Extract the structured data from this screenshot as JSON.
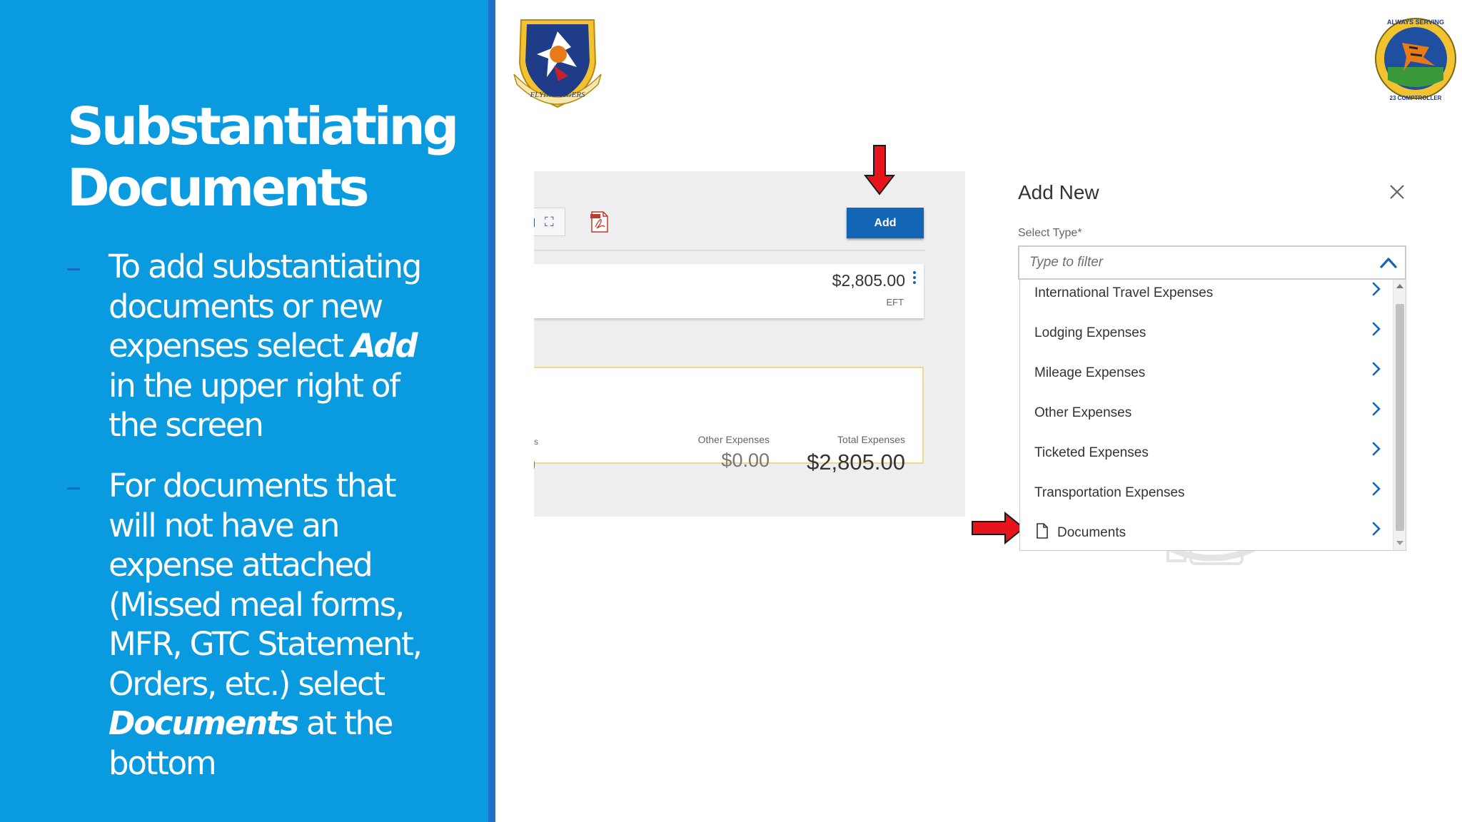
{
  "slide": {
    "title": "Substantiating Documents",
    "bullet1": {
      "pre": "To add substantiating documents or new expenses select ",
      "em": "Add",
      "post": " in the upper right of the screen"
    },
    "bullet2": {
      "pre": "For documents that will not have an expense attached (Missed meal forms, MFR, GTC Statement, Orders, etc.) select ",
      "em": "Documents",
      "post": " at the bottom"
    }
  },
  "emblems": {
    "left_text": "FLYING TIGERS",
    "right_top": "ALWAYS SERVING",
    "right_bottom": "23 COMPTROLLER"
  },
  "expense_view": {
    "add_label": "Add",
    "amount": "$2,805.00",
    "payment_method": "EFT",
    "prev_col_label": "s",
    "prev_col_value": ")",
    "other_label": "Other Expenses",
    "other_value": "$0.00",
    "total_label": "Total Expenses",
    "total_value": "$2,805.00"
  },
  "dialog": {
    "title": "Add New",
    "select_label": "Select Type*",
    "filter_placeholder": "Type to filter",
    "items": [
      {
        "label": "International Travel Expenses"
      },
      {
        "label": "Lodging Expenses"
      },
      {
        "label": "Mileage Expenses"
      },
      {
        "label": "Other Expenses"
      },
      {
        "label": "Ticketed Expenses"
      },
      {
        "label": "Transportation Expenses"
      },
      {
        "label": "Documents"
      }
    ]
  },
  "colors": {
    "panel_blue": "#0a9ae0",
    "button_blue": "#1266b5",
    "arrow_red": "#e8141c",
    "card_border": "#ecd98a"
  },
  "icons": [
    "expand-icon",
    "pdf-icon",
    "kebab-icon",
    "close-icon",
    "chevron-up-icon",
    "chevron-right-icon",
    "document-icon",
    "red-arrow-icon"
  ]
}
